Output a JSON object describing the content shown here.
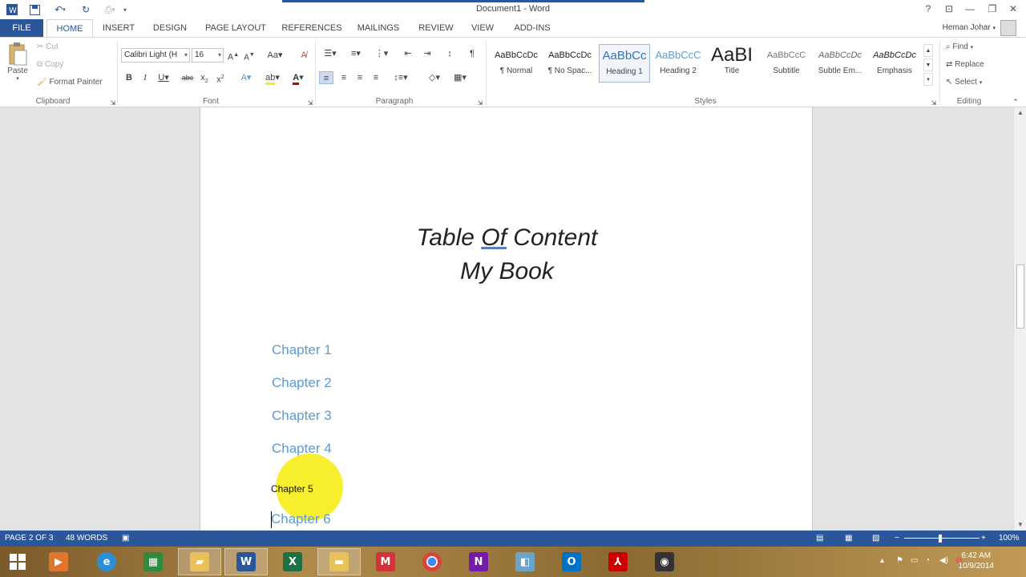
{
  "window": {
    "title": "Document1 - Word"
  },
  "titlebar": {
    "help": "?",
    "ribbon_display": "⊡",
    "minimize": "—",
    "restore": "❐",
    "close": "✕"
  },
  "tabs": [
    "FILE",
    "HOME",
    "INSERT",
    "DESIGN",
    "PAGE LAYOUT",
    "REFERENCES",
    "MAILINGS",
    "REVIEW",
    "VIEW",
    "ADD-INS"
  ],
  "user": {
    "name": "Heman Johar"
  },
  "clipboard": {
    "paste": "Paste",
    "cut": "Cut",
    "copy": "Copy",
    "format_painter": "Format Painter",
    "group_label": "Clipboard"
  },
  "font": {
    "name": "Calibri Light (H",
    "size": "16",
    "group_label": "Font"
  },
  "paragraph": {
    "group_label": "Paragraph"
  },
  "styles": {
    "group_label": "Styles",
    "items": [
      {
        "sample": "AaBbCcDc",
        "name": "¶ Normal"
      },
      {
        "sample": "AaBbCcDc",
        "name": "¶ No Spac..."
      },
      {
        "sample": "AaBbCc",
        "name": "Heading 1"
      },
      {
        "sample": "AaBbCcC",
        "name": "Heading 2"
      },
      {
        "sample": "AaBI",
        "name": "Title"
      },
      {
        "sample": "AaBbCcC",
        "name": "Subtitle"
      },
      {
        "sample": "AaBbCcDc",
        "name": "Subtle Em..."
      },
      {
        "sample": "AaBbCcDc",
        "name": "Emphasis"
      }
    ]
  },
  "editing": {
    "find": "Find",
    "replace": "Replace",
    "select": "Select",
    "group_label": "Editing"
  },
  "document": {
    "title_line1_a": "Table ",
    "title_line1_b": "Of",
    "title_line1_c": " Content",
    "title_line2": "My Book",
    "chapters": [
      "Chapter 1",
      "Chapter 2",
      "Chapter 3",
      "Chapter 4",
      "Chapter 5",
      "Chapter 6"
    ]
  },
  "status": {
    "page": "PAGE 2 OF 3",
    "words": "48 WORDS",
    "zoom": "100%"
  },
  "taskbar": {
    "time": "6:42 AM",
    "date": "10/9/2014"
  },
  "colors": {
    "word_blue": "#2b579a",
    "heading_blue": "#5b9bd5",
    "highlight_yellow": "#f6ee1c"
  }
}
